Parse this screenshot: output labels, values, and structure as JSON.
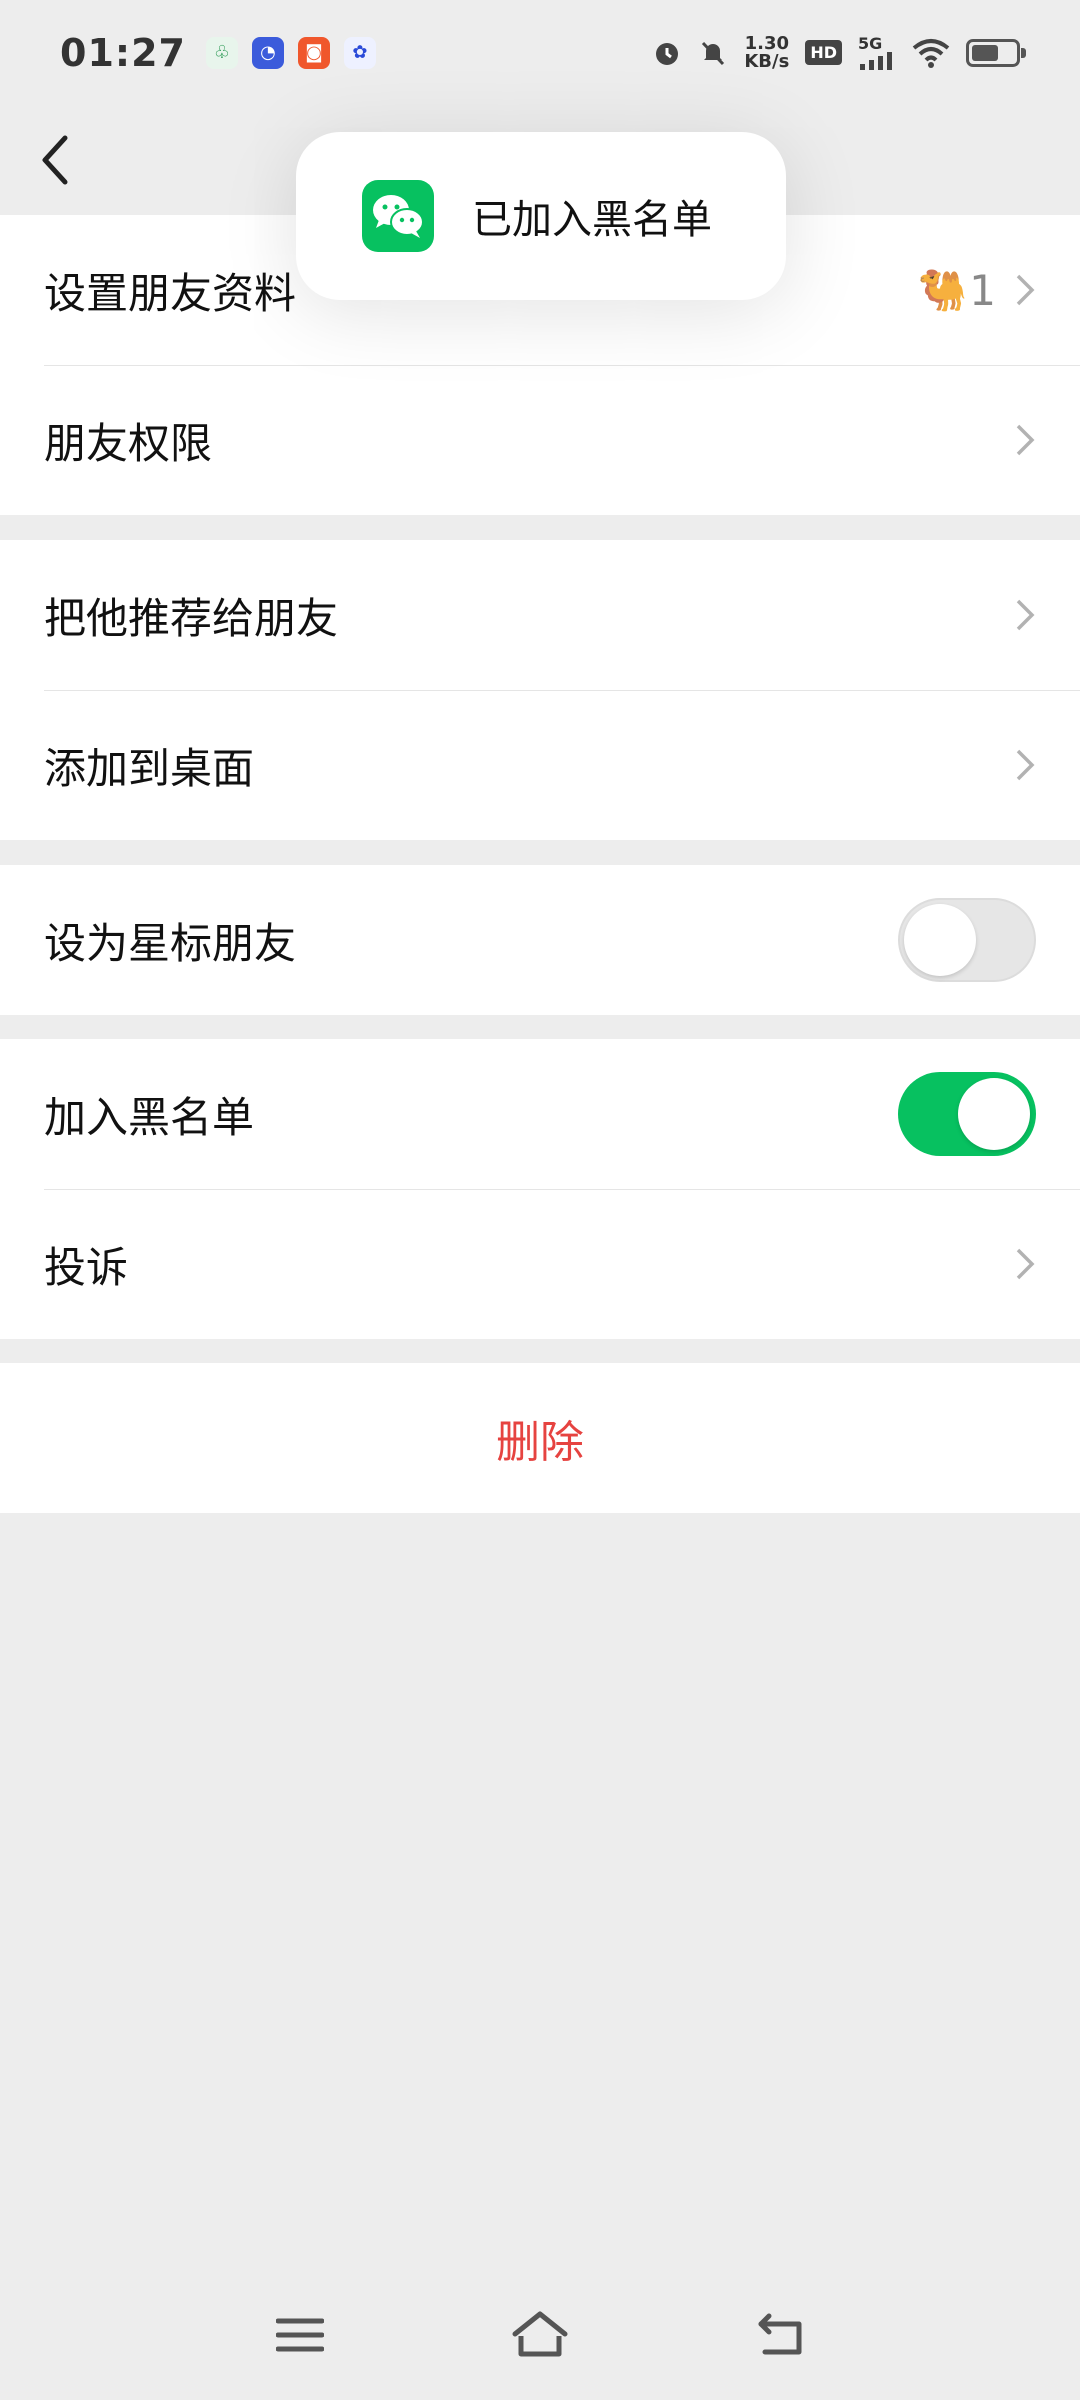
{
  "status_bar": {
    "time": "01:27",
    "notification_icons": [
      "app-icon-1",
      "qq-icon",
      "app-icon-3",
      "baidu-icon"
    ],
    "speed_value": "1.30",
    "speed_unit": "KB/s",
    "hd_label": "HD",
    "network_label": "5G"
  },
  "nav": {
    "back_icon": "chevron-left-icon"
  },
  "toast": {
    "icon": "wechat-icon",
    "text": "已加入黑名单"
  },
  "groups": [
    {
      "rows": [
        {
          "label": "设置朋友资料",
          "value_emoji": "🐫",
          "value_text": "1",
          "type": "link"
        },
        {
          "label": "朋友权限",
          "type": "link"
        }
      ]
    },
    {
      "rows": [
        {
          "label": "把他推荐给朋友",
          "type": "link"
        },
        {
          "label": "添加到桌面",
          "type": "link"
        }
      ]
    },
    {
      "rows": [
        {
          "label": "设为星标朋友",
          "type": "toggle",
          "on": false
        }
      ]
    },
    {
      "rows": [
        {
          "label": "加入黑名单",
          "type": "toggle",
          "on": true
        },
        {
          "label": "投诉",
          "type": "link"
        }
      ]
    }
  ],
  "delete_label": "删除",
  "system_nav": [
    "menu-icon",
    "home-icon",
    "back-icon"
  ],
  "colors": {
    "accent_green": "#07c160",
    "danger_red": "#e64340",
    "background": "#ededed"
  }
}
